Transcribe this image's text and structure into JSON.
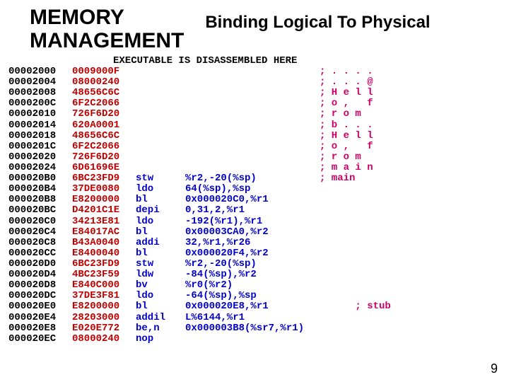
{
  "header": {
    "left_line1": "MEMORY",
    "left_line2": "MANAGEMENT",
    "right": "Binding Logical To Physical"
  },
  "banner": "EXECUTABLE IS DISASSEMBLED HERE",
  "rows": [
    {
      "addr": "00002000",
      "bytes": "0009000F",
      "mnem": "",
      "args": "",
      "cmt": "; . . . ."
    },
    {
      "addr": "00002004",
      "bytes": "08000240",
      "mnem": "",
      "args": "",
      "cmt": "; . . . @"
    },
    {
      "addr": "00002008",
      "bytes": "48656C6C",
      "mnem": "",
      "args": "",
      "cmt": "; H e l l"
    },
    {
      "addr": "0000200C",
      "bytes": "6F2C2066",
      "mnem": "",
      "args": "",
      "cmt": "; o ,   f"
    },
    {
      "addr": "00002010",
      "bytes": "726F6D20",
      "mnem": "",
      "args": "",
      "cmt": "; r o m"
    },
    {
      "addr": "00002014",
      "bytes": "620A0001",
      "mnem": "",
      "args": "",
      "cmt": "; b . . ."
    },
    {
      "addr": "00002018",
      "bytes": "48656C6C",
      "mnem": "",
      "args": "",
      "cmt": "; H e l l"
    },
    {
      "addr": "0000201C",
      "bytes": "6F2C2066",
      "mnem": "",
      "args": "",
      "cmt": "; o ,   f"
    },
    {
      "addr": "00002020",
      "bytes": "726F6D20",
      "mnem": "",
      "args": "",
      "cmt": "; r o m"
    },
    {
      "addr": "00002024",
      "bytes": "6D61696E",
      "mnem": "",
      "args": "",
      "cmt": "; m a i n"
    },
    {
      "addr": "000020B0",
      "bytes": "6BC23FD9",
      "mnem": "stw",
      "args": "%r2,-20(%sp)",
      "cmt": "; main"
    },
    {
      "addr": "000020B4",
      "bytes": "37DE0080",
      "mnem": "ldo",
      "args": "64(%sp),%sp",
      "cmt": ""
    },
    {
      "addr": "000020B8",
      "bytes": "E8200000",
      "mnem": "bl",
      "args": "0x000020C0,%r1",
      "cmt": ""
    },
    {
      "addr": "000020BC",
      "bytes": "D4201C1E",
      "mnem": "depi",
      "args": "0,31,2,%r1",
      "cmt": ""
    },
    {
      "addr": "000020C0",
      "bytes": "34213E81",
      "mnem": "ldo",
      "args": "-192(%r1),%r1",
      "cmt": ""
    },
    {
      "addr": "000020C4",
      "bytes": "E84017AC",
      "mnem": "bl",
      "args": "0x00003CA0,%r2",
      "cmt": ""
    },
    {
      "addr": "000020C8",
      "bytes": "B43A0040",
      "mnem": "addi",
      "args": "32,%r1,%r26",
      "cmt": ""
    },
    {
      "addr": "000020CC",
      "bytes": "E8400040",
      "mnem": "bl",
      "args": "0x000020F4,%r2",
      "cmt": ""
    },
    {
      "addr": "000020D0",
      "bytes": "6BC23FD9",
      "mnem": "stw",
      "args": "%r2,-20(%sp)",
      "cmt": ""
    },
    {
      "addr": "000020D4",
      "bytes": "4BC23F59",
      "mnem": "ldw",
      "args": "-84(%sp),%r2",
      "cmt": ""
    },
    {
      "addr": "000020D8",
      "bytes": "E840C000",
      "mnem": "bv",
      "args": "%r0(%r2)",
      "cmt": ""
    },
    {
      "addr": "000020DC",
      "bytes": "37DE3F81",
      "mnem": "ldo",
      "args": "-64(%sp),%sp",
      "cmt": ""
    },
    {
      "addr": "000020E0",
      "bytes": "E8200000",
      "mnem": "bl",
      "args": "0x000020E8,%r1",
      "cmt": "      ; stub"
    },
    {
      "addr": "000020E4",
      "bytes": "28203000",
      "mnem": "addil",
      "args": "L%6144,%r1",
      "cmt": ""
    },
    {
      "addr": "000020E8",
      "bytes": "E020E772",
      "mnem": "be,n",
      "args": "0x000003B8(%sr7,%r1)",
      "cmt": ""
    },
    {
      "addr": "000020EC",
      "bytes": "08000240",
      "mnem": "nop",
      "args": "",
      "cmt": ""
    }
  ],
  "page_number": "9"
}
